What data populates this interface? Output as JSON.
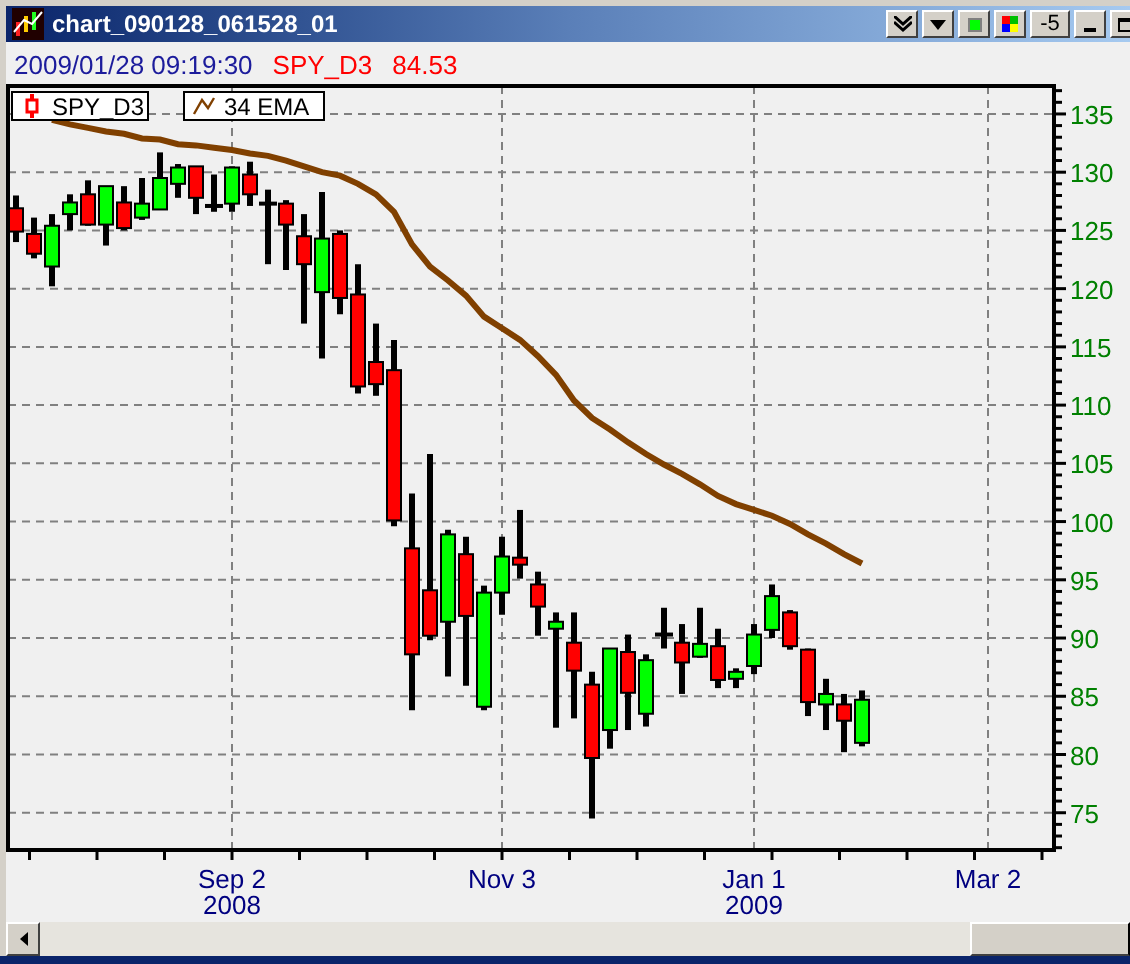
{
  "window": {
    "title": "chart_090128_061528_01",
    "buttons": [
      {
        "kind": "double-down"
      },
      {
        "kind": "down"
      },
      {
        "kind": "green"
      },
      {
        "kind": "colors"
      },
      {
        "kind": "text",
        "label": "-5"
      },
      {
        "kind": "minimize"
      },
      {
        "kind": "maximize"
      }
    ]
  },
  "header": {
    "timestamp": "2009/01/28 09:19:30",
    "symbol": "SPY_D3",
    "price": "84.53"
  },
  "chart_data": {
    "type": "candlestick",
    "grid": true,
    "legend": true,
    "categories": [
      null,
      null,
      null,
      null,
      null,
      null,
      null,
      null,
      null,
      null,
      null,
      null,
      "Sep 2\n2008",
      null,
      null,
      null,
      null,
      null,
      null,
      null,
      null,
      null,
      null,
      null,
      null,
      null,
      null,
      "Nov 3",
      null,
      null,
      null,
      null,
      null,
      null,
      null,
      null,
      null,
      null,
      null,
      null,
      null,
      "Jan 1\n2009",
      null,
      null,
      null,
      null,
      null,
      null,
      null,
      null,
      null,
      null,
      null,
      null,
      "Mar 2",
      null,
      null,
      null
    ],
    "ylim": [
      71.8,
      137.4
    ],
    "yticks": [
      75,
      80,
      85,
      90,
      95,
      100,
      105,
      110,
      115,
      120,
      125,
      130,
      135
    ],
    "series": [
      {
        "name": "SPY_D3",
        "ohlc": [
          [
            126.9,
            128.0,
            124.0,
            124.9
          ],
          [
            124.7,
            126.1,
            122.6,
            123.0
          ],
          [
            121.9,
            126.4,
            120.2,
            125.4
          ],
          [
            126.4,
            128.1,
            125.0,
            127.4
          ],
          [
            128.1,
            129.3,
            125.4,
            125.5
          ],
          [
            125.5,
            128.8,
            123.7,
            128.8
          ],
          [
            127.4,
            128.8,
            125.0,
            125.2
          ],
          [
            126.1,
            129.5,
            125.9,
            127.3
          ],
          [
            126.8,
            131.7,
            126.8,
            129.5
          ],
          [
            129.0,
            130.7,
            127.8,
            130.4
          ],
          [
            130.5,
            130.5,
            126.4,
            127.8
          ],
          [
            127.1,
            129.8,
            126.6,
            127.1
          ],
          [
            127.3,
            130.5,
            126.6,
            130.4
          ],
          [
            129.8,
            130.9,
            127.1,
            128.1
          ],
          [
            127.3,
            128.5,
            122.1,
            127.3
          ],
          [
            127.3,
            127.6,
            121.6,
            125.5
          ],
          [
            124.5,
            126.4,
            117.0,
            122.1
          ],
          [
            119.7,
            128.3,
            114.0,
            124.3
          ],
          [
            124.7,
            125.0,
            117.8,
            119.2
          ],
          [
            119.5,
            122.1,
            111.0,
            111.6
          ],
          [
            113.7,
            117.0,
            110.8,
            111.8
          ],
          [
            113.0,
            115.6,
            99.6,
            100.1
          ],
          [
            97.7,
            102.4,
            83.8,
            88.6
          ],
          [
            94.1,
            105.8,
            89.8,
            90.2
          ],
          [
            91.4,
            99.3,
            86.7,
            98.9
          ],
          [
            97.2,
            98.7,
            85.9,
            91.9
          ],
          [
            84.1,
            94.5,
            83.8,
            93.9
          ],
          [
            93.9,
            98.7,
            92.0,
            97.0
          ],
          [
            96.9,
            101.0,
            95.1,
            96.3
          ],
          [
            94.6,
            95.7,
            90.2,
            92.7
          ],
          [
            90.8,
            92.2,
            82.3,
            91.4
          ],
          [
            89.6,
            92.2,
            83.1,
            87.2
          ],
          [
            86.0,
            87.1,
            74.5,
            79.7
          ],
          [
            82.1,
            89.1,
            80.5,
            89.1
          ],
          [
            88.8,
            90.3,
            82.1,
            85.3
          ],
          [
            83.5,
            88.6,
            82.4,
            88.1
          ],
          [
            90.3,
            92.6,
            89.1,
            90.3
          ],
          [
            89.6,
            91.2,
            85.2,
            87.9
          ],
          [
            88.4,
            92.6,
            88.3,
            89.5
          ],
          [
            89.3,
            90.8,
            85.7,
            86.4
          ],
          [
            86.5,
            87.4,
            85.7,
            87.1
          ],
          [
            87.6,
            91.2,
            86.9,
            90.3
          ],
          [
            90.7,
            94.6,
            90.0,
            93.6
          ],
          [
            92.2,
            92.4,
            89.0,
            89.3
          ],
          [
            89.0,
            89.1,
            83.3,
            84.5
          ],
          [
            84.3,
            86.5,
            82.1,
            85.2
          ],
          [
            84.3,
            85.2,
            80.2,
            82.9
          ],
          [
            81.0,
            85.5,
            80.7,
            84.7
          ],
          null,
          null,
          null,
          null,
          null,
          null,
          null,
          null,
          null,
          null
        ]
      },
      {
        "name": "34 EMA",
        "type": "line",
        "color": "#804000",
        "values": [
          null,
          null,
          134.5,
          134.1,
          133.8,
          133.5,
          133.3,
          132.9,
          132.8,
          132.4,
          132.3,
          132.1,
          131.9,
          131.6,
          131.4,
          131.0,
          130.5,
          130.0,
          129.7,
          129.0,
          128.1,
          126.6,
          123.8,
          121.9,
          120.7,
          119.4,
          117.6,
          116.6,
          115.6,
          114.2,
          112.6,
          110.4,
          108.9,
          107.9,
          106.8,
          105.8,
          104.9,
          104.1,
          103.2,
          102.2,
          101.5,
          101.0,
          100.5,
          99.8,
          98.9,
          98.1,
          97.2,
          96.4,
          null,
          null,
          null,
          null,
          null,
          null,
          null,
          null,
          null,
          null
        ]
      }
    ]
  }
}
